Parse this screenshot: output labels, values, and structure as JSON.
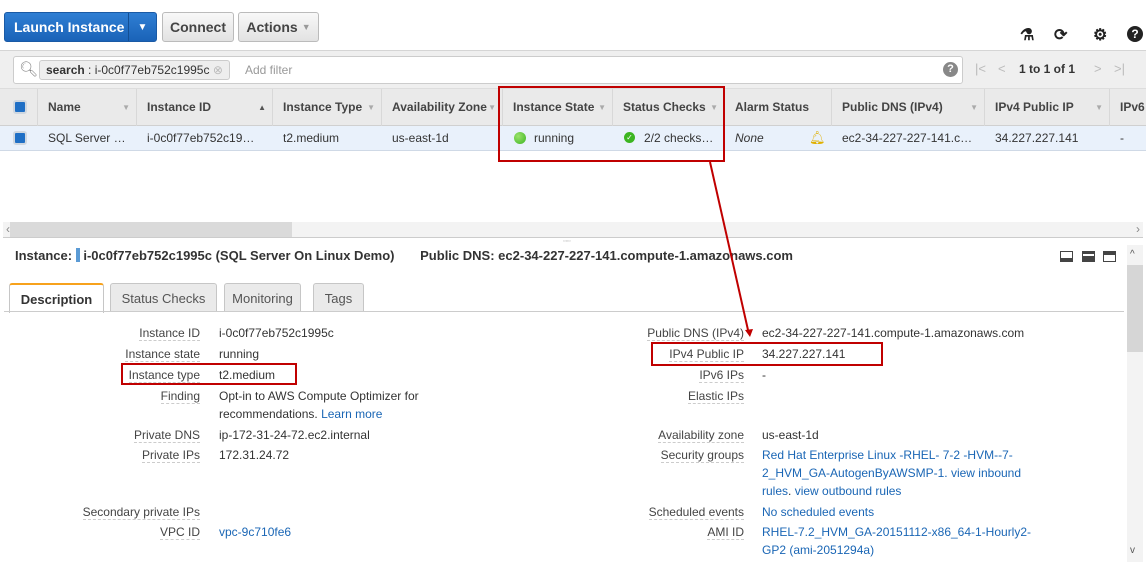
{
  "toolbar": {
    "launch": "Launch Instance",
    "connect": "Connect",
    "actions": "Actions",
    "icons": [
      "flask-icon",
      "refresh-icon",
      "gear-icon",
      "help-icon"
    ]
  },
  "filter": {
    "token_key": "search",
    "token_value": " : i-0c0f77eb752c1995c",
    "placeholder": "Add filter",
    "pagination": "1 to 1 of 1"
  },
  "table": {
    "columns": [
      "Name",
      "Instance ID",
      "Instance Type",
      "Availability Zone",
      "Instance State",
      "Status Checks",
      "Alarm Status",
      "Public DNS (IPv4)",
      "IPv4 Public IP",
      "IPv6"
    ],
    "row": {
      "name": "SQL Server …",
      "instance_id": "i-0c0f77eb752c19…",
      "type": "t2.medium",
      "zone": "us-east-1d",
      "state": "running",
      "checks": "2/2 checks…",
      "alarm": "None",
      "dns": "ec2-34-227-227-141.c…",
      "ip": "34.227.227.141",
      "ipv6": "-"
    }
  },
  "details": {
    "instance_label": "Instance:",
    "instance_value": "i-0c0f77eb752c1995c (SQL Server On Linux Demo)",
    "dns_label": "Public DNS:",
    "dns_value": "ec2-34-227-227-141.compute-1.amazonaws.com",
    "tabs": [
      "Description",
      "Status Checks",
      "Monitoring",
      "Tags"
    ],
    "left": [
      [
        "Instance ID",
        "i-0c0f77eb752c1995c"
      ],
      [
        "Instance state",
        "running"
      ],
      [
        "Instance type",
        "t2.medium"
      ],
      [
        "Finding",
        "Opt-in to AWS Compute Optimizer for recommendations."
      ],
      [
        "Private DNS",
        "ip-172-31-24-72.ec2.internal"
      ],
      [
        "Private IPs",
        "172.31.24.72"
      ],
      [
        "Secondary private IPs",
        ""
      ],
      [
        "VPC ID",
        "vpc-9c710fe6"
      ]
    ],
    "learn_more": "Learn more",
    "right": [
      [
        "Public DNS (IPv4)",
        "ec2-34-227-227-141.compute-1.amazonaws.com"
      ],
      [
        "IPv4 Public IP",
        "34.227.227.141"
      ],
      [
        "IPv6 IPs",
        "-"
      ],
      [
        "Elastic IPs",
        ""
      ],
      [
        "Availability zone",
        "us-east-1d"
      ],
      [
        "Security groups",
        "Red Hat Enterprise Linux -RHEL- 7-2 -HVM--7-2_HVM_GA-AutogenByAWSMP-1."
      ],
      [
        "Scheduled events",
        "No scheduled events"
      ],
      [
        "AMI ID",
        "RHEL-7.2_HVM_GA-20151112-x86_64-1-Hourly2-GP2 (ami-2051294a)"
      ]
    ],
    "sg_inbound": "view inbound rules",
    "sg_outbound": "view outbound rules"
  },
  "colors": {
    "accent": "#1f6fc5",
    "annotation": "#c00000",
    "running": "#3cb521"
  }
}
